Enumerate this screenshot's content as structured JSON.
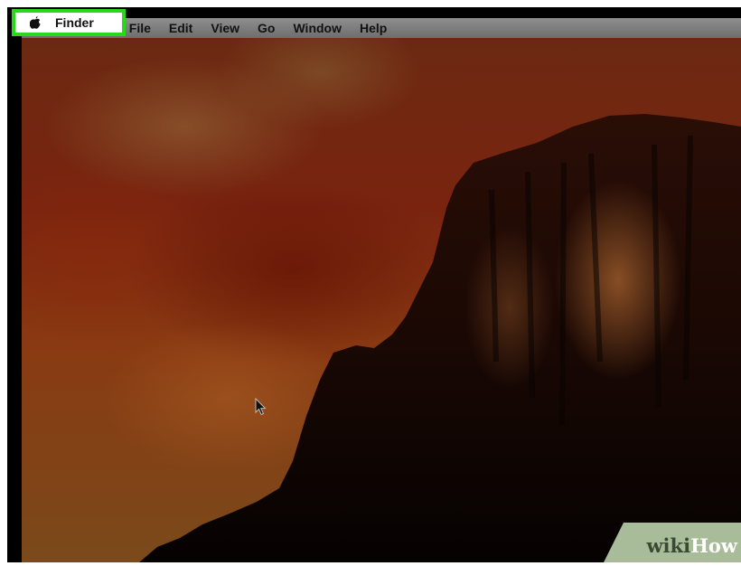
{
  "menubar": {
    "apple_icon": "apple-logo-icon",
    "app_name": "Finder",
    "items": [
      "File",
      "Edit",
      "View",
      "Go",
      "Window",
      "Help"
    ]
  },
  "highlight_color": "#29d81a",
  "watermark": {
    "part1": "wiki",
    "part2": "How"
  }
}
